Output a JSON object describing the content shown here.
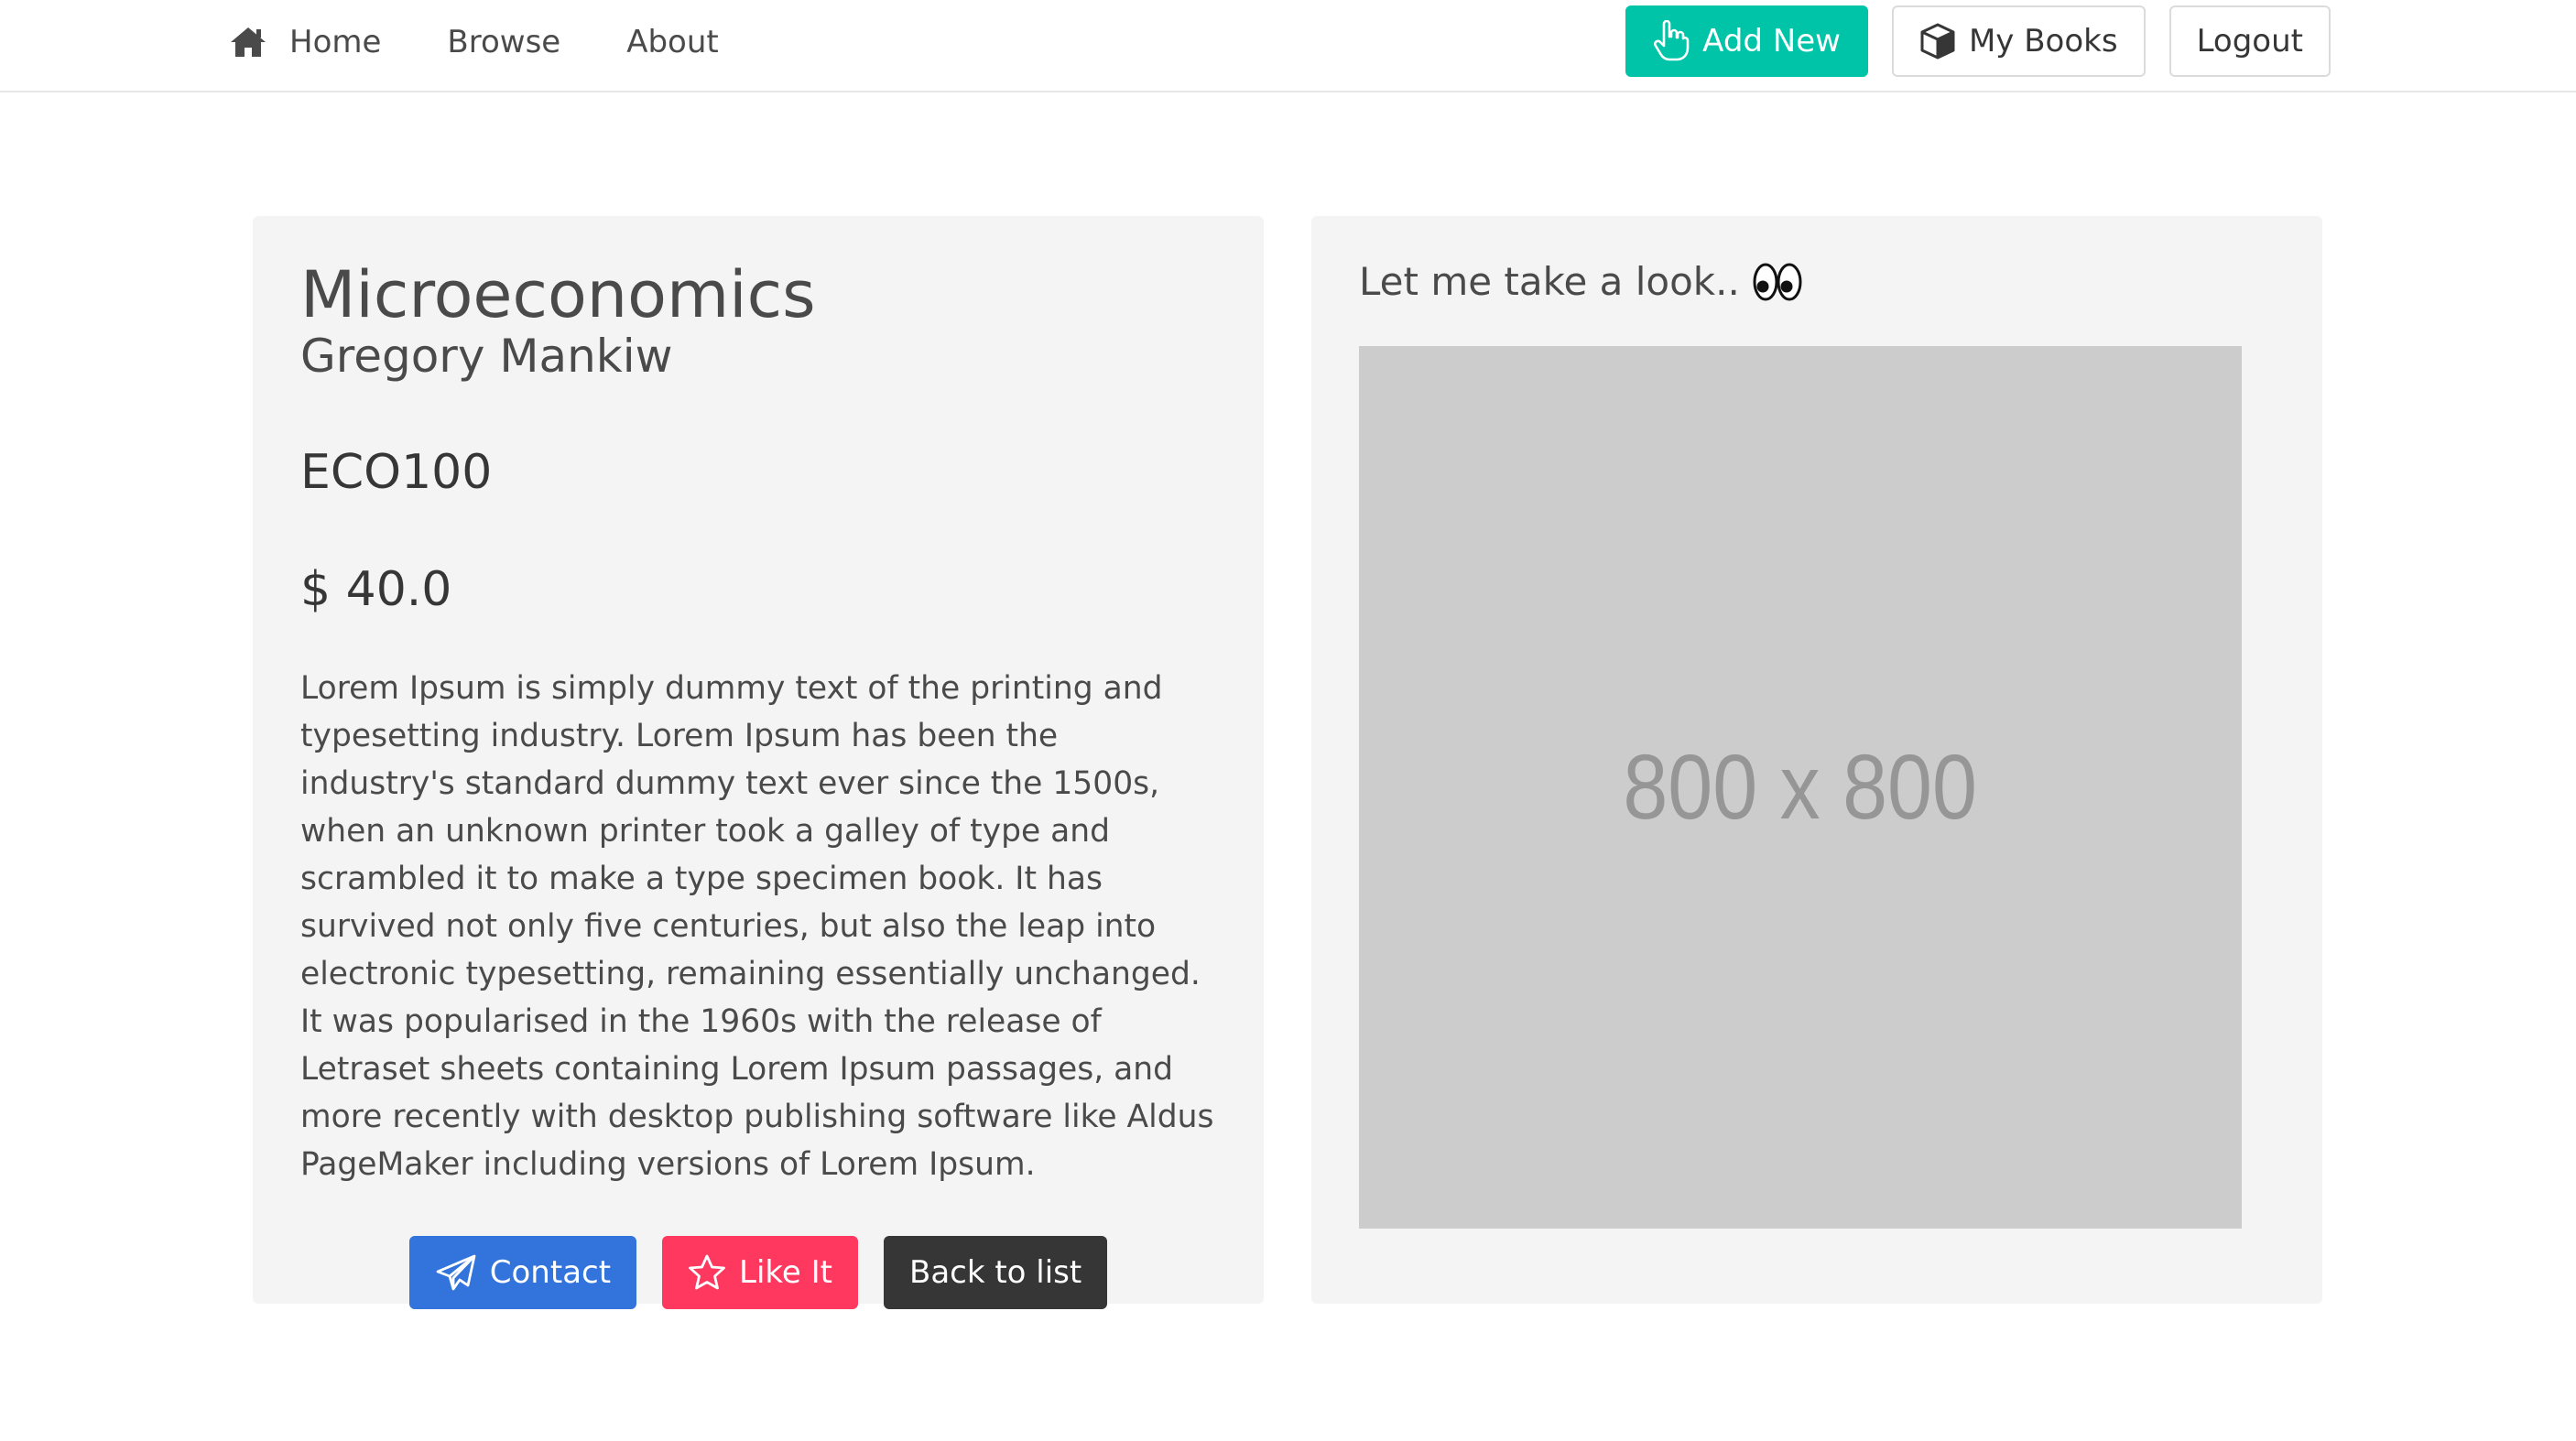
{
  "nav": {
    "home_label": "Home",
    "browse_label": "Browse",
    "about_label": "About",
    "add_new_label": "Add New",
    "my_books_label": "My Books",
    "logout_label": "Logout"
  },
  "book": {
    "title": "Microeconomics",
    "author": "Gregory Mankiw",
    "course": "ECO100",
    "price": "$ 40.0",
    "description": "Lorem Ipsum is simply dummy text of the printing and typesetting industry. Lorem Ipsum has been the industry's standard dummy text ever since the 1500s, when an unknown printer took a galley of type and scrambled it to make a type specimen book. It has survived not only five centuries, but also the leap into electronic typesetting, remaining essentially unchanged. It was popularised in the 1960s with the release of Letraset sheets containing Lorem Ipsum passages, and more recently with desktop publishing software like Aldus PageMaker including versions of Lorem Ipsum."
  },
  "actions": {
    "contact_label": "Contact",
    "like_label": "Like It",
    "back_label": "Back to list"
  },
  "preview": {
    "heading": "Let me take a look..",
    "image_placeholder_text": "800 x 800"
  },
  "icons": {
    "home": "home-icon",
    "add_new": "hand-pointer-icon",
    "my_books": "cube-icon",
    "contact": "paper-plane-icon",
    "like": "star-icon",
    "peek": "eyes-icon"
  },
  "colors": {
    "teal": "#00c4a7",
    "blue": "#3273dc",
    "pink": "#ff3860",
    "dark": "#363636",
    "card_bg": "#f4f4f4",
    "placeholder_bg": "#cccccc"
  }
}
